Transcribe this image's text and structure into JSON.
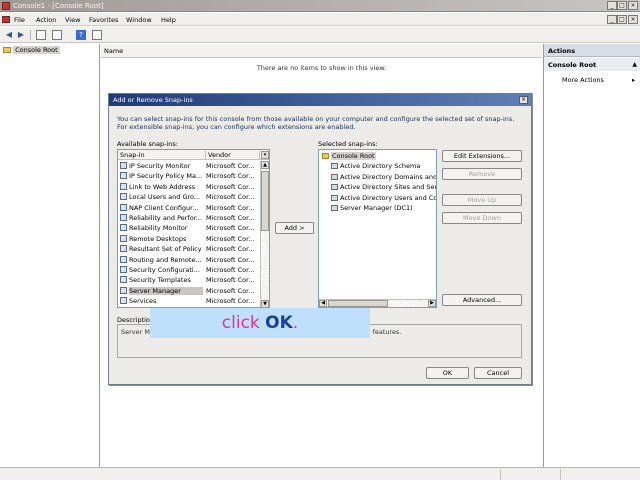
{
  "window": {
    "title": "Console1 - [Console Root]",
    "controls": [
      "_",
      "□",
      "×"
    ],
    "doc_controls": [
      "_",
      "□",
      "×"
    ]
  },
  "menu": [
    "File",
    "Action",
    "View",
    "Favorites",
    "Window",
    "Help"
  ],
  "toolbar": {
    "icons": [
      "back-icon",
      "forward-icon",
      "show-tree-icon",
      "properties-icon",
      "help-icon",
      "show-action-pane-icon"
    ]
  },
  "tree": {
    "root": "Console Root"
  },
  "center": {
    "column_header": "Name",
    "empty_message": "There are no items to show in this view."
  },
  "actions": {
    "header": "Actions",
    "section": "Console Root",
    "items": [
      "More Actions"
    ]
  },
  "dialog": {
    "title": "Add or Remove Snap-ins",
    "close": "×",
    "intro": "You can select snap-ins for this console from those available on your computer and configure the selected set of snap-ins. For extensible snap-ins, you can configure which extensions are enabled.",
    "available_label": "Available snap-ins:",
    "columns": [
      "Snap-in",
      "Vendor"
    ],
    "available": [
      {
        "name": "IP Security Monitor",
        "vendor": "Microsoft Cor..."
      },
      {
        "name": "IP Security Policy Ma...",
        "vendor": "Microsoft Cor..."
      },
      {
        "name": "Link to Web Address",
        "vendor": "Microsoft Cor..."
      },
      {
        "name": "Local Users and Gro...",
        "vendor": "Microsoft Cor..."
      },
      {
        "name": "NAP Client Configur...",
        "vendor": "Microsoft Cor..."
      },
      {
        "name": "Reliability and Perfor...",
        "vendor": "Microsoft Cor..."
      },
      {
        "name": "Reliability Monitor",
        "vendor": "Microsoft Cor..."
      },
      {
        "name": "Remote Desktops",
        "vendor": "Microsoft Cor..."
      },
      {
        "name": "Resultant Set of Policy",
        "vendor": "Microsoft Cor..."
      },
      {
        "name": "Routing and Remote...",
        "vendor": "Microsoft Cor..."
      },
      {
        "name": "Security Configurati...",
        "vendor": "Microsoft Cor..."
      },
      {
        "name": "Security Templates",
        "vendor": "Microsoft Cor..."
      },
      {
        "name": "Server Manager",
        "vendor": "Microsoft Cor..."
      },
      {
        "name": "Services",
        "vendor": "Microsoft Cor..."
      }
    ],
    "selected_index": 12,
    "add_button": "Add >",
    "selected_label": "Selected snap-ins:",
    "selected_root": "Console Root",
    "selected": [
      "Active Directory Schema",
      "Active Directory Domains and Trusts",
      "Active Directory Sites and Services",
      "Active Directory Users and Computers",
      "Server Manager (DC1)"
    ],
    "buttons": {
      "edit_extensions": "Edit Extensions...",
      "remove": "Remove",
      "move_up": "Move Up",
      "move_down": "Move Down",
      "advanced": "Advanced..."
    },
    "description_label": "Description:",
    "description": "Server Manager is a tool that can be used to add or remove server roles and features.",
    "ok": "OK",
    "cancel": "Cancel"
  },
  "overlay": {
    "word1": "click",
    "word2": "OK",
    "word3": "."
  }
}
